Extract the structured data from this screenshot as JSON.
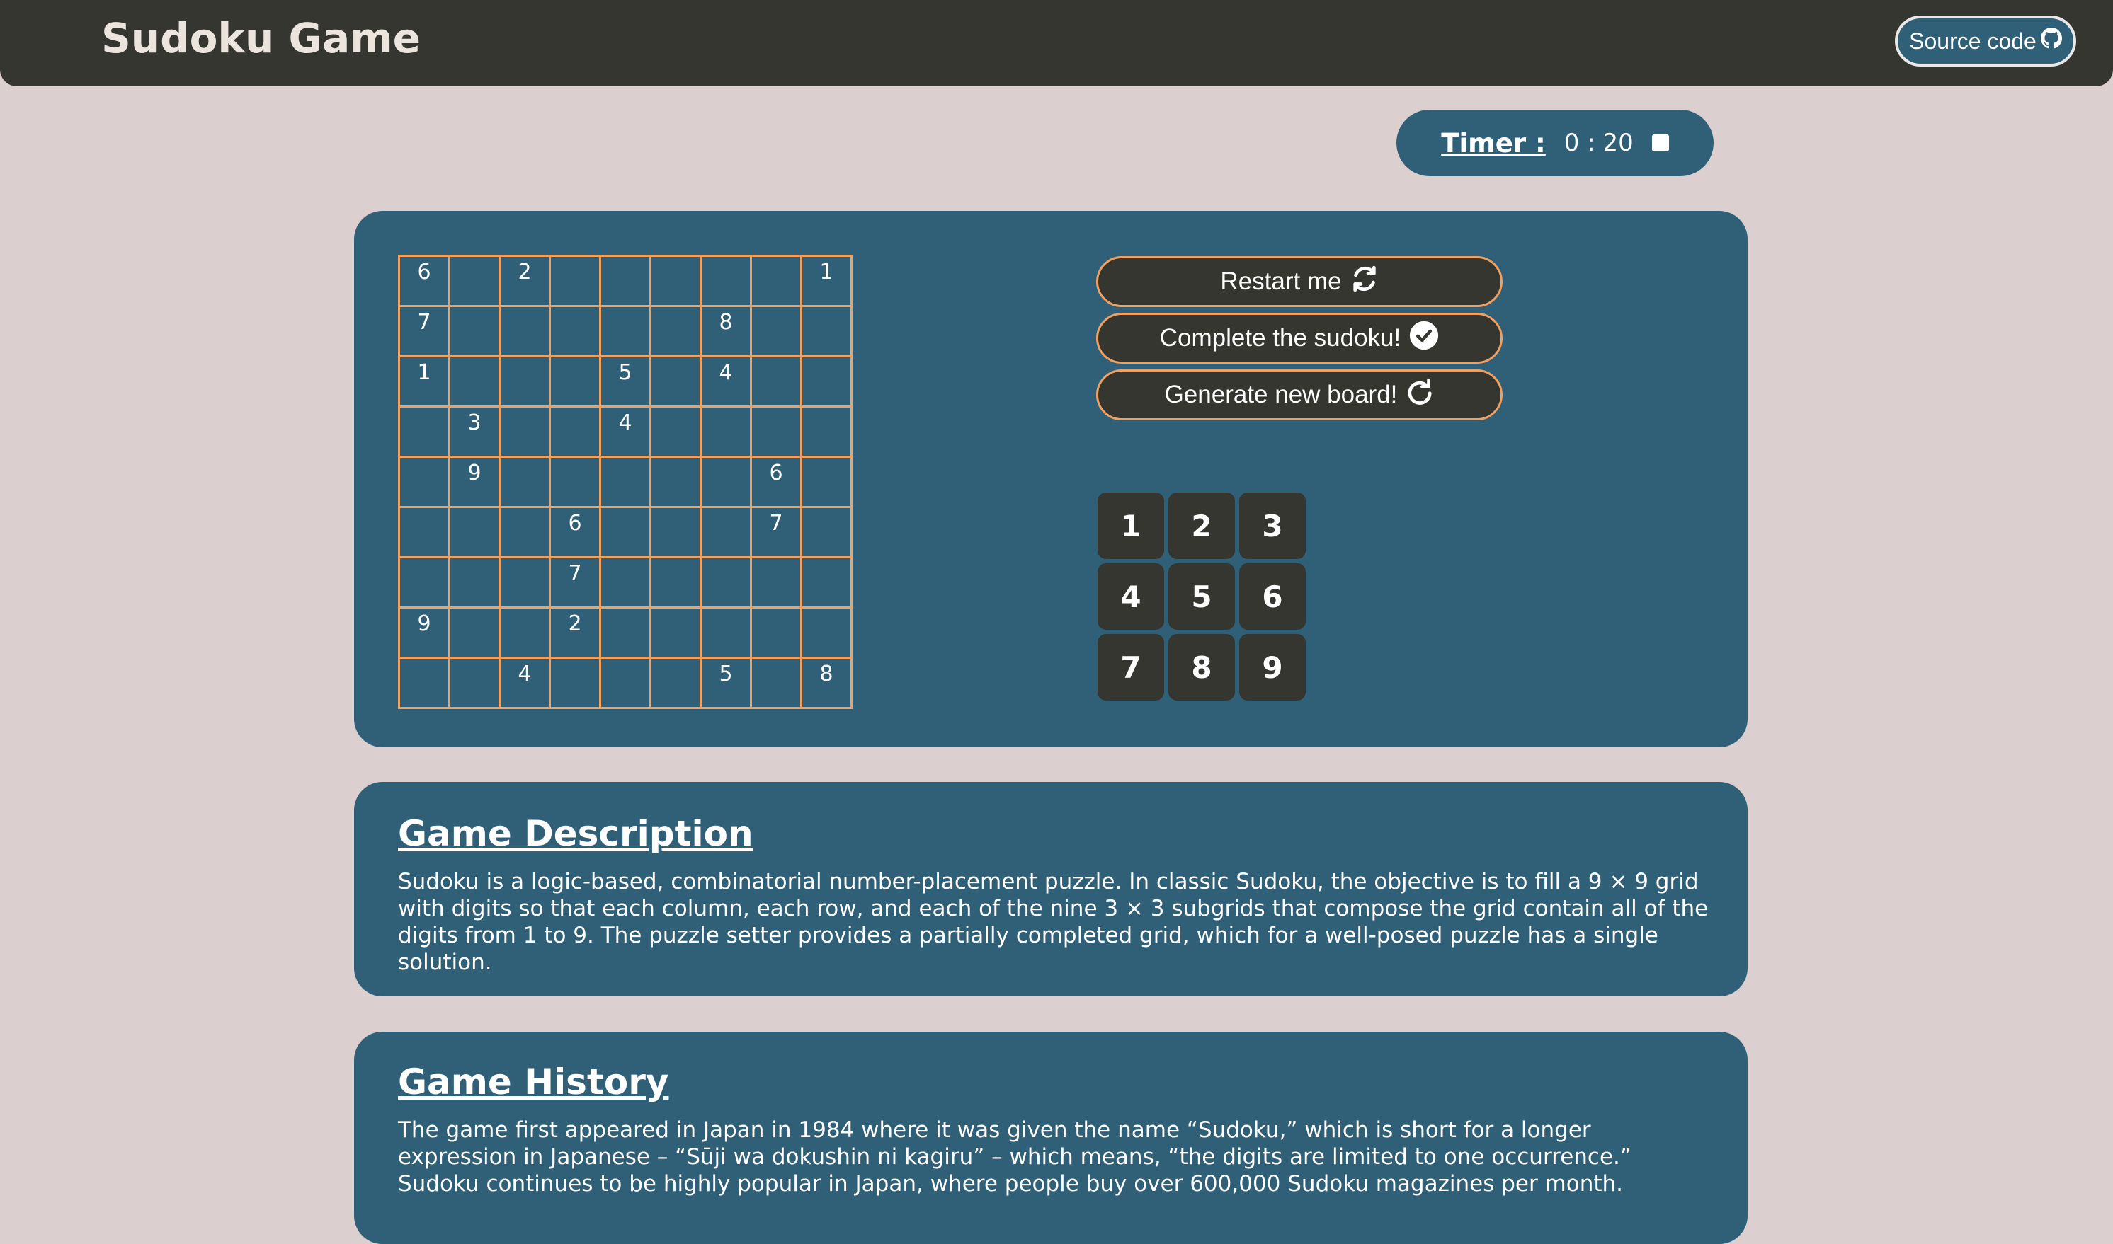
{
  "header": {
    "title": "Sudoku Game",
    "source_label": "Source code",
    "source_icon": "github-icon"
  },
  "timer": {
    "label": "Timer :",
    "value": "0 : 20",
    "icon": "stop-icon"
  },
  "board": [
    [
      "6",
      "",
      "2",
      "",
      "",
      "",
      "",
      "",
      "1"
    ],
    [
      "7",
      "",
      "",
      "",
      "",
      "",
      "8",
      "",
      ""
    ],
    [
      "1",
      "",
      "",
      "",
      "5",
      "",
      "4",
      "",
      ""
    ],
    [
      "",
      "3",
      "",
      "",
      "4",
      "",
      "",
      "",
      ""
    ],
    [
      "",
      "9",
      "",
      "",
      "",
      "",
      "",
      "6",
      ""
    ],
    [
      "",
      "",
      "",
      "6",
      "",
      "",
      "",
      "7",
      ""
    ],
    [
      "",
      "",
      "",
      "7",
      "",
      "",
      "",
      "",
      ""
    ],
    [
      "9",
      "",
      "",
      "2",
      "",
      "",
      "",
      "",
      ""
    ],
    [
      "",
      "",
      "4",
      "",
      "",
      "",
      "5",
      "",
      "8"
    ]
  ],
  "controls": {
    "restart_label": "Restart me",
    "complete_label": "Complete the sudoku!",
    "generate_label": "Generate new board!"
  },
  "numpad": [
    "1",
    "2",
    "3",
    "4",
    "5",
    "6",
    "7",
    "8",
    "9"
  ],
  "description": {
    "title": "Game Description",
    "text": "Sudoku is a logic-based, combinatorial number-placement puzzle. In classic Sudoku, the objective is to fill a 9 × 9 grid with digits so that each column, each row, and each of the nine 3 × 3 subgrids that compose the grid contain all of the digits from 1 to 9. The puzzle setter provides a partially completed grid, which for a well-posed puzzle has a single solution."
  },
  "history": {
    "title": "Game History",
    "text": "The game first appeared in Japan in 1984 where it was given the name “Sudoku,” which is short for a longer expression in Japanese – “Sūji wa dokushin ni kagiru” – which means, “the digits are limited to one occurrence.” Sudoku continues to be highly popular in Japan, where people buy over 600,000 Sudoku magazines per month."
  },
  "colors": {
    "background": "#dbcfcf",
    "header": "#363630",
    "panel": "#2f6078",
    "grid_line": "#f0a060",
    "button": "#363630"
  }
}
